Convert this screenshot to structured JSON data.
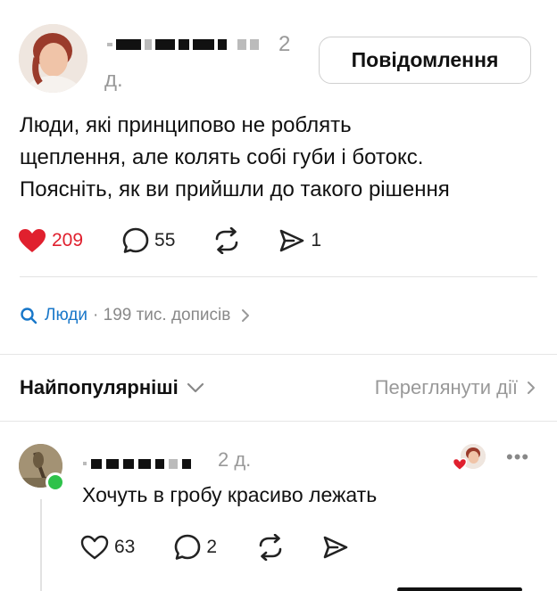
{
  "post": {
    "time_part1": "2",
    "time_part2": "д.",
    "message_button": "Повідомлення",
    "text_lines": [
      "Люди, які принципово не роблять",
      "щеплення, але колять собі губи і ботокс.",
      "Поясніть, як ви прийшли до такого рішення"
    ],
    "likes": "209",
    "comments": "55",
    "shares": "1"
  },
  "topic": {
    "name": "Люди",
    "meta": "· 199 тис. дописів"
  },
  "sort": {
    "title": "Найпопулярніші",
    "view_activity": "Переглянути дії"
  },
  "reply": {
    "time": "2 д.",
    "text": "Хочуть в гробу красиво лежать",
    "likes": "63",
    "comments": "2",
    "more": "•••"
  },
  "colors": {
    "like_red": "#e0202e",
    "link_blue": "#1877c9",
    "online_green": "#2ec24a"
  },
  "icons": [
    "heart-icon",
    "comment-icon",
    "repost-icon",
    "share-icon",
    "search-icon",
    "chevron-right-icon",
    "chevron-down-icon",
    "more-icon"
  ]
}
